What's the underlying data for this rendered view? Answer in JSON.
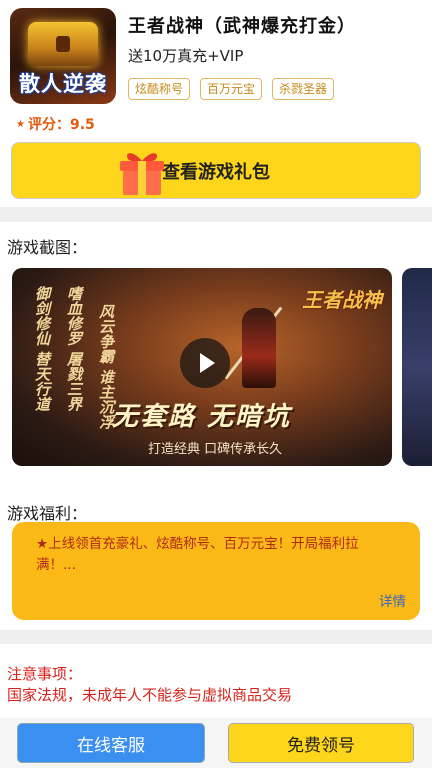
{
  "app": {
    "icon_text": "散人逆袭",
    "title": "王者战神（武神爆充打金）",
    "subtitle": "送10万真充+VIP",
    "tags": [
      "炫酷称号",
      "百万元宝",
      "杀戮圣器"
    ],
    "rating_label": "评分：9.5",
    "gift_button": "查看游戏礼包"
  },
  "screenshots": {
    "title": "游戏截图：",
    "items": [
      {
        "logo": "王者战神",
        "poem_col1": "御剑修仙 替天行道",
        "poem_col2": "嗜血修罗 屠戮三界",
        "poem_col3": "风云争霸 谁主沉浮",
        "slogan": "无套路 无暗坑",
        "slogan_sub": "打造经典 口碑传承长久"
      }
    ]
  },
  "welfare": {
    "title": "游戏福利：",
    "text": "★上线领首充豪礼、炫酷称号、百万元宝！开局福利拉满！...",
    "detail_link": "详情"
  },
  "notes": {
    "title": "注意事项：",
    "text": "国家法规，未成年人不能参与虚拟商品交易"
  },
  "bottom": {
    "service_button": "在线客服",
    "free_button": "免费领号"
  },
  "colors": {
    "accent_yellow": "#fdd51a",
    "welfare_orange": "#fbb917",
    "warning_red": "#d8231b",
    "service_blue": "#3b8ff0",
    "rating_orange": "#e45a0c"
  }
}
